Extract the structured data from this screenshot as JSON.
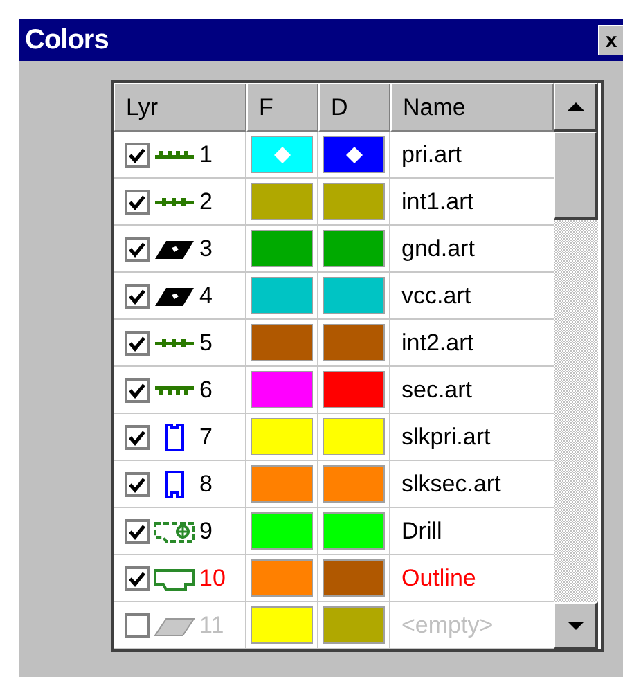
{
  "window": {
    "title": "Colors",
    "close": "x"
  },
  "table": {
    "columns": [
      "Lyr",
      "F",
      "D",
      "Name"
    ],
    "rows": [
      {
        "checked": true,
        "kind": "trace-top",
        "number": "1",
        "swatches": [
          {
            "color": "#00ffff",
            "marked": true
          },
          {
            "color": "#0000ff",
            "marked": true
          }
        ],
        "name": "pri.art",
        "color": "#000000"
      },
      {
        "checked": true,
        "kind": "trace-inner",
        "number": "2",
        "swatches": [
          {
            "color": "#b0a800",
            "marked": false
          },
          {
            "color": "#b0a800",
            "marked": false
          }
        ],
        "name": "int1.art",
        "color": "#000000"
      },
      {
        "checked": true,
        "kind": "plane",
        "number": "3",
        "swatches": [
          {
            "color": "#00aa00",
            "marked": false
          },
          {
            "color": "#00aa00",
            "marked": false
          }
        ],
        "name": "gnd.art",
        "color": "#000000"
      },
      {
        "checked": true,
        "kind": "plane",
        "number": "4",
        "swatches": [
          {
            "color": "#00c4c4",
            "marked": false
          },
          {
            "color": "#00c4c4",
            "marked": false
          }
        ],
        "name": "vcc.art",
        "color": "#000000"
      },
      {
        "checked": true,
        "kind": "trace-inner",
        "number": "5",
        "swatches": [
          {
            "color": "#b05800",
            "marked": false
          },
          {
            "color": "#b05800",
            "marked": false
          }
        ],
        "name": "int2.art",
        "color": "#000000"
      },
      {
        "checked": true,
        "kind": "trace-bottom",
        "number": "6",
        "swatches": [
          {
            "color": "#ff00ff",
            "marked": false
          },
          {
            "color": "#ff0000",
            "marked": false
          }
        ],
        "name": "sec.art",
        "color": "#000000"
      },
      {
        "checked": true,
        "kind": "silk-top",
        "number": "7",
        "swatches": [
          {
            "color": "#ffff00",
            "marked": false
          },
          {
            "color": "#ffff00",
            "marked": false
          }
        ],
        "name": "slkpri.art",
        "color": "#000000"
      },
      {
        "checked": true,
        "kind": "silk-bottom",
        "number": "8",
        "swatches": [
          {
            "color": "#ff8000",
            "marked": false
          },
          {
            "color": "#ff8000",
            "marked": false
          }
        ],
        "name": "slksec.art",
        "color": "#000000"
      },
      {
        "checked": true,
        "kind": "drill",
        "number": "9",
        "swatches": [
          {
            "color": "#00ff00",
            "marked": false
          },
          {
            "color": "#00ff00",
            "marked": false
          }
        ],
        "name": "Drill",
        "color": "#000000"
      },
      {
        "checked": true,
        "kind": "outline",
        "number": "10",
        "swatches": [
          {
            "color": "#ff8000",
            "marked": false
          },
          {
            "color": "#b05800",
            "marked": false
          }
        ],
        "name": "Outline",
        "color": "#ff0000"
      },
      {
        "checked": false,
        "kind": "empty",
        "number": "11",
        "swatches": [
          {
            "color": "#ffff00",
            "marked": false
          },
          {
            "color": "#b0a800",
            "marked": false
          }
        ],
        "name": "<empty>",
        "color": "#c0c0c0"
      }
    ]
  }
}
